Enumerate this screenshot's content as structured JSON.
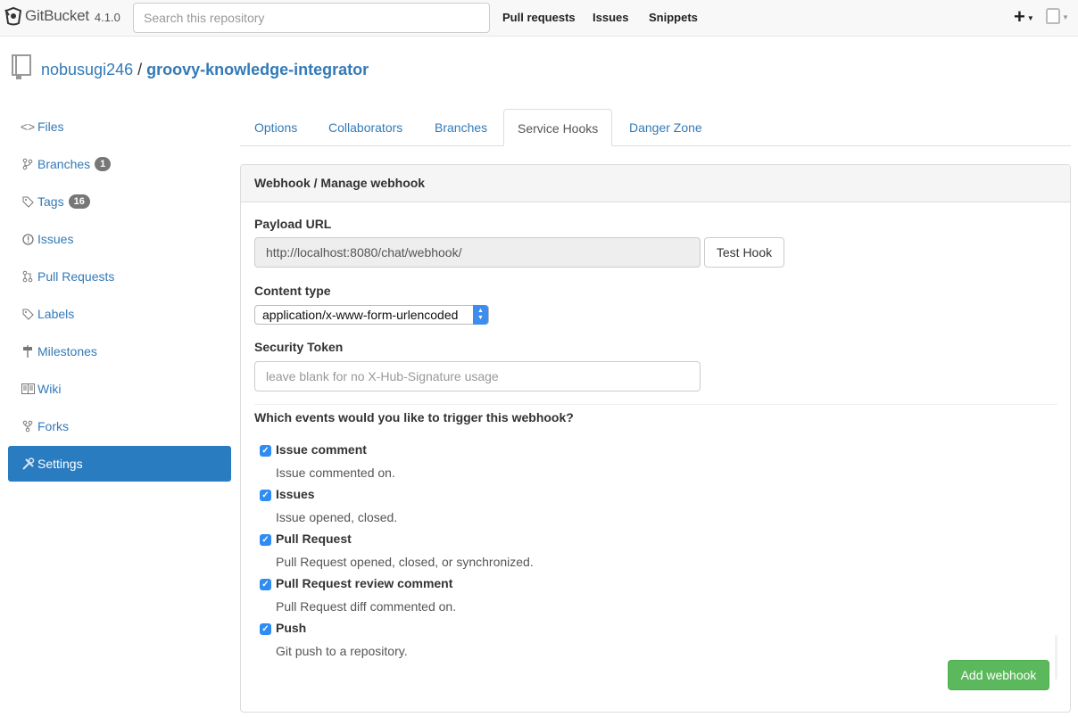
{
  "navbar": {
    "brand": "GitBucket",
    "version": "4.1.0",
    "search_placeholder": "Search this repository",
    "links": [
      "Pull requests",
      "Issues",
      "Snippets"
    ],
    "plus": "+"
  },
  "repo": {
    "owner": "nobusugi246",
    "separator": "/",
    "name": "groovy-knowledge-integrator"
  },
  "sidebar": {
    "items": [
      {
        "label": "Files",
        "icon": "code-icon"
      },
      {
        "label": "Branches",
        "icon": "branch-icon",
        "badge": "1"
      },
      {
        "label": "Tags",
        "icon": "tag-icon",
        "badge": "16"
      },
      {
        "label": "Issues",
        "icon": "issue-icon"
      },
      {
        "label": "Pull Requests",
        "icon": "pull-request-icon"
      },
      {
        "label": "Labels",
        "icon": "label-icon"
      },
      {
        "label": "Milestones",
        "icon": "milestone-icon"
      },
      {
        "label": "Wiki",
        "icon": "wiki-icon"
      },
      {
        "label": "Forks",
        "icon": "fork-icon"
      },
      {
        "label": "Settings",
        "icon": "tools-icon",
        "active": true
      }
    ]
  },
  "tabs": [
    {
      "label": "Options"
    },
    {
      "label": "Collaborators"
    },
    {
      "label": "Branches"
    },
    {
      "label": "Service Hooks",
      "active": true
    },
    {
      "label": "Danger Zone"
    }
  ],
  "panel": {
    "heading": "Webhook / Manage webhook",
    "payload_label": "Payload URL",
    "payload_value": "http://localhost:8080/chat/webhook/",
    "test_button": "Test Hook",
    "content_type_label": "Content type",
    "content_type_value": "application/x-www-form-urlencoded",
    "token_label": "Security Token",
    "token_placeholder": "leave blank for no X-Hub-Signature usage",
    "events_question": "Which events would you like to trigger this webhook?",
    "events": [
      {
        "name": "Issue comment",
        "desc": "Issue commented on.",
        "checked": true
      },
      {
        "name": "Issues",
        "desc": "Issue opened, closed.",
        "checked": true
      },
      {
        "name": "Pull Request",
        "desc": "Pull Request opened, closed, or synchronized.",
        "checked": true
      },
      {
        "name": "Pull Request review comment",
        "desc": "Pull Request diff commented on.",
        "checked": true
      },
      {
        "name": "Push",
        "desc": "Git push to a repository.",
        "checked": true
      }
    ],
    "add_button": "Add webhook"
  },
  "colors": {
    "link": "#337ab7",
    "active_sidebar": "#2a7cc0",
    "add_button": "#5cb85c",
    "checkbox": "#2f8cf3"
  }
}
